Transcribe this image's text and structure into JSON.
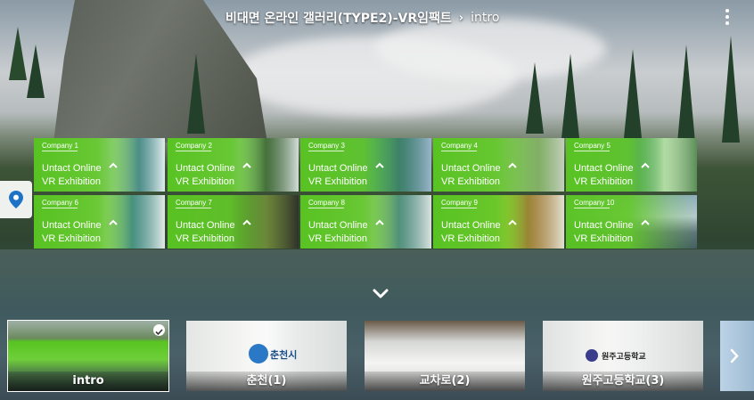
{
  "header": {
    "gallery_title": "비대면 온라인 갤러리(TYPE2)-VR임팩트",
    "separator": "›",
    "scene_name": "intro"
  },
  "icons": {
    "menu": "more-vertical-icon",
    "location": "map-pin-icon",
    "expand": "chevron-down-icon",
    "next": "chevron-right-icon",
    "selected": "check-circle-icon"
  },
  "colors": {
    "card_green": "#58c421",
    "location_pin": "#1f73c7"
  },
  "hotspots": [
    {
      "company": "Company 1",
      "line1": "Untact Online",
      "line2": "VR Exhibition"
    },
    {
      "company": "Company 2",
      "line1": "Untact Online",
      "line2": "VR Exhibition"
    },
    {
      "company": "Company 3",
      "line1": "Untact Online",
      "line2": "VR Exhibition"
    },
    {
      "company": "Company 4",
      "line1": "Untact Online",
      "line2": "VR Exhibition"
    },
    {
      "company": "Company 5",
      "line1": "Untact Online",
      "line2": "VR Exhibition"
    },
    {
      "company": "Company 6",
      "line1": "Untact Online",
      "line2": "VR Exhibition"
    },
    {
      "company": "Company 7",
      "line1": "Untact Online",
      "line2": "VR Exhibition"
    },
    {
      "company": "Company 8",
      "line1": "Untact Online",
      "line2": "VR Exhibition"
    },
    {
      "company": "Company 9",
      "line1": "Untact Online",
      "line2": "VR Exhibition"
    },
    {
      "company": "Company 10",
      "line1": "Untact Online",
      "line2": "VR Exhibition"
    }
  ],
  "scenes": [
    {
      "label": "intro",
      "selected": true
    },
    {
      "label": "춘천(1)",
      "selected": false
    },
    {
      "label": "교차로(2)",
      "selected": false
    },
    {
      "label": "원주고등학교(3)",
      "selected": false
    }
  ],
  "thumb_text": {
    "chuncheon_logo": "춘천시",
    "wonju_logo": "원주고등학교"
  }
}
